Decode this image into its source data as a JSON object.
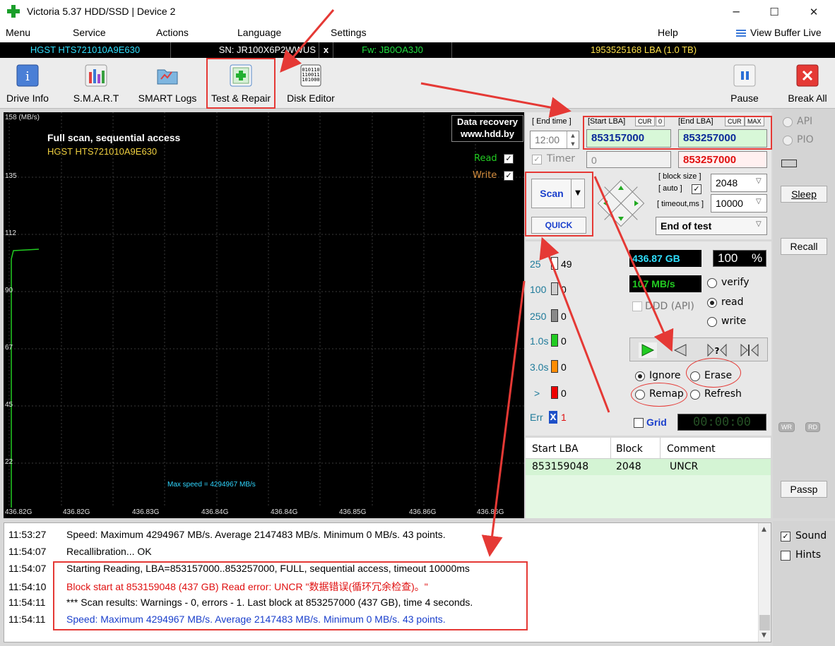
{
  "window": {
    "title": "Victoria 5.37 HDD/SSD | Device 2",
    "minimize": "─",
    "maximize": "☐",
    "close": "✕"
  },
  "menu": {
    "items": [
      "Menu",
      "Service",
      "Actions",
      "Language",
      "Settings"
    ],
    "help": "Help",
    "view_buffer": "View Buffer Live"
  },
  "device": {
    "model": "HGST HTS721010A9E630",
    "serial": "SN: JR100X6P2WWUS",
    "close": "x",
    "firmware": "Fw: JB0OA3J0",
    "lba": "1953525168 LBA (1.0 TB)"
  },
  "toolbar": {
    "drive_info": "Drive Info",
    "smart": "S.M.A.R.T",
    "smart_logs": "SMART Logs",
    "test_repair": "Test & Repair",
    "disk_editor": "Disk Editor",
    "pause": "Pause",
    "break_all": "Break All"
  },
  "graph": {
    "title": "Full scan, sequential access",
    "model": "HGST HTS721010A9E630",
    "unit": "158 (MB/s)",
    "y_ticks": [
      "135",
      "112",
      "90",
      "67",
      "45",
      "22"
    ],
    "x_ticks": [
      "436.82G",
      "436.82G",
      "436.83G",
      "436.84G",
      "436.84G",
      "436.85G",
      "436.86G",
      "436.86G"
    ],
    "max_speed": "Max speed = 4294967 MB/s",
    "watermark_l1": "Data recovery",
    "watermark_l2": "www.hdd.by",
    "read_label": "Read",
    "write_label": "Write",
    "check": "✓"
  },
  "controls": {
    "end_time_label": "[ End time ]",
    "end_time": "12:00",
    "timer": "Timer",
    "timer_value": "0",
    "start_lba_label": "[Start LBA]",
    "cur": "CUR",
    "zero": "0",
    "start_lba": "853157000",
    "end_lba_label": "[End LBA]",
    "max": "MAX",
    "end_lba": "853257000",
    "end_lba_current": "853257000",
    "scan": "Scan",
    "quick": "QUICK",
    "block_size_label": "[ block size ]",
    "auto_label": "[ auto ]",
    "block_size": "2048",
    "timeout_label": "[ timeout,ms ]",
    "timeout": "10000",
    "end_of_test": "End of test"
  },
  "stats": {
    "rows": [
      {
        "label": "25",
        "count": "49",
        "color": "#ffffff"
      },
      {
        "label": "100",
        "count": "0",
        "color": "#cfcfcf"
      },
      {
        "label": "250",
        "count": "0",
        "color": "#8a8a8a"
      },
      {
        "label": "1.0s",
        "count": "0",
        "color": "#22cc22"
      },
      {
        "label": "3.0s",
        "count": "0",
        "color": "#ff8c00"
      },
      {
        "label": ">",
        "count": "0",
        "color": "#ee0000"
      },
      {
        "label": "Err",
        "count": "1",
        "color": "#1e50c8"
      }
    ],
    "err_mark": "X",
    "size": "436.87 GB",
    "percent": "100",
    "percent_sign": "%",
    "speed": "107 MB/s",
    "ddd": "DDD (API)",
    "verify": "verify",
    "read": "read",
    "write": "write",
    "ignore": "Ignore",
    "erase": "Erase",
    "remap": "Remap",
    "refresh": "Refresh",
    "grid": "Grid",
    "clock": "00:00:00"
  },
  "table": {
    "headers": [
      "Start LBA",
      "Block",
      "Comment"
    ],
    "rows": [
      [
        "853159048",
        "2048",
        "UNCR"
      ]
    ]
  },
  "side": {
    "api": "API",
    "pio": "PIO",
    "sleep": "Sleep",
    "recall": "Recall",
    "wr": "WR",
    "rd": "RD",
    "passp": "Passp",
    "sound": "Sound",
    "hints": "Hints"
  },
  "log": [
    {
      "time": "11:53:27",
      "text": "Speed: Maximum 4294967 MB/s. Average 2147483 MB/s. Minimum 0 MB/s. 43 points.",
      "color": "#000000"
    },
    {
      "time": "11:54:07",
      "text": "Recallibration... OK",
      "color": "#000000"
    },
    {
      "time": "11:54:07",
      "text": "Starting Reading, LBA=853157000..853257000, FULL, sequential access, timeout 10000ms",
      "color": "#000000"
    },
    {
      "time": "11:54:10",
      "text": "Block start at 853159048 (437 GB) Read error: UNCR \"数据错误(循环冗余检查)。\"",
      "color": "#e01010"
    },
    {
      "time": "11:54:11",
      "text": "*** Scan results: Warnings - 0, errors - 1. Last block at 853257000 (437 GB), time 4 seconds.",
      "color": "#000000"
    },
    {
      "time": "11:54:11",
      "text": "Speed: Maximum 4294967 MB/s. Average 2147483 MB/s. Minimum 0 MB/s. 43 points.",
      "color": "#1a3fcc"
    }
  ],
  "colors": {
    "accent": "#e53935",
    "graph_green": "#22cc22",
    "cyan": "#00e5ff"
  }
}
